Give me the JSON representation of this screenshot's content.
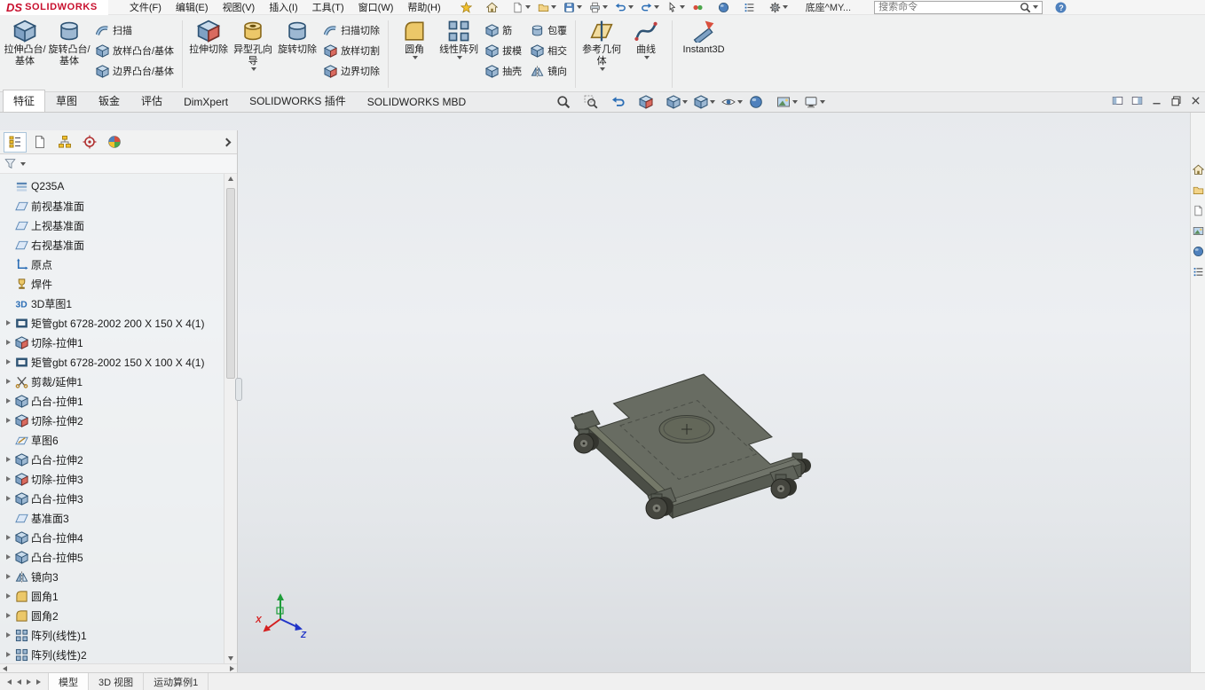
{
  "brand": {
    "ds": "DS",
    "name": "SOLIDWORKS"
  },
  "menubar": {
    "menus": [
      "文件(F)",
      "编辑(E)",
      "视图(V)",
      "插入(I)",
      "工具(T)",
      "窗口(W)",
      "帮助(H)"
    ],
    "quick_access": [
      {
        "icon": "favorites",
        "glyph": "star",
        "caret": false
      },
      {
        "icon": "home",
        "glyph": "home",
        "caret": false
      },
      {
        "icon": "new-document",
        "glyph": "page",
        "caret": true
      },
      {
        "icon": "open",
        "glyph": "folder",
        "caret": true
      },
      {
        "icon": "save",
        "glyph": "floppy",
        "caret": true
      },
      {
        "icon": "print",
        "glyph": "printer",
        "caret": true
      },
      {
        "icon": "undo",
        "glyph": "undo",
        "caret": true
      },
      {
        "icon": "redo",
        "glyph": "redo",
        "caret": true
      },
      {
        "icon": "select",
        "glyph": "cursor",
        "caret": true
      },
      {
        "icon": "rebuild",
        "glyph": "rebuild",
        "caret": false
      },
      {
        "icon": "appearances",
        "glyph": "sphere",
        "caret": false
      },
      {
        "icon": "file-properties",
        "glyph": "list",
        "caret": false
      },
      {
        "icon": "options",
        "glyph": "gear",
        "caret": true
      }
    ],
    "document_title": "底座^MY...",
    "search": {
      "placeholder": "搜索命令"
    }
  },
  "ribbon": {
    "extrude_boss": "拉伸凸台/基体",
    "revolve_boss": "旋转凸台/基体",
    "swept_boss": "扫描",
    "lofted_boss": "放样凸台/基体",
    "boundary_boss": "边界凸台/基体",
    "extruded_cut": "拉伸切除",
    "hole_wizard": "异型孔向导",
    "revolved_cut": "旋转切除",
    "swept_cut": "扫描切除",
    "lofted_cut": "放样切割",
    "boundary_cut": "边界切除",
    "fillet": "圆角",
    "linear_pattern": "线性阵列",
    "rib": "筋",
    "draft": "拔模",
    "shell": "抽壳",
    "wrap": "包覆",
    "intersect": "相交",
    "mirror": "镜向",
    "reference_geometry": "参考几何体",
    "curves": "曲线",
    "instant3d": "Instant3D"
  },
  "command_tabs": {
    "items": [
      "特征",
      "草图",
      "钣金",
      "评估",
      "DimXpert",
      "SOLIDWORKS 插件",
      "SOLIDWORKS MBD"
    ],
    "active_index": 0
  },
  "headsup": {
    "buttons": [
      {
        "icon": "zoom-to-fit",
        "glyph": "magnifier",
        "caret": false
      },
      {
        "icon": "zoom-to-area",
        "glyph": "zoomarea",
        "caret": false
      },
      {
        "icon": "previous-view",
        "glyph": "undo",
        "caret": false
      },
      {
        "icon": "section-view",
        "glyph": "cube-red",
        "caret": false
      },
      {
        "icon": "view-orientation",
        "glyph": "cube",
        "caret": true
      },
      {
        "icon": "display-style",
        "glyph": "cube",
        "caret": true
      },
      {
        "icon": "hide-show-items",
        "glyph": "eye",
        "caret": true
      },
      {
        "icon": "edit-appearance",
        "glyph": "sphere",
        "caret": false
      },
      {
        "icon": "apply-scene",
        "glyph": "photo",
        "caret": true
      },
      {
        "icon": "view-settings",
        "glyph": "monitor",
        "caret": true
      }
    ]
  },
  "window_controls": {
    "buttons": [
      {
        "icon": "toggle-left-pane",
        "glyph": "pane-left"
      },
      {
        "icon": "toggle-right-pane",
        "glyph": "pane-right"
      },
      {
        "icon": "minimize",
        "glyph": "win-min"
      },
      {
        "icon": "restore",
        "glyph": "win-restore"
      },
      {
        "icon": "close",
        "glyph": "win-close"
      }
    ]
  },
  "left_panel": {
    "tabs": [
      {
        "icon": "feature-manager",
        "glyph": "treeicon"
      },
      {
        "icon": "property-manager",
        "glyph": "page"
      },
      {
        "icon": "configuration-manager",
        "glyph": "branch"
      },
      {
        "icon": "dimxpert-manager",
        "glyph": "target"
      },
      {
        "icon": "display-manager",
        "glyph": "palette"
      }
    ],
    "tree_items": [
      {
        "label": "Q235A",
        "icon": "material",
        "glyph": "bars",
        "expand": false
      },
      {
        "label": "前视基准面",
        "icon": "reference-plane",
        "glyph": "plane",
        "expand": false
      },
      {
        "label": "上视基准面",
        "icon": "reference-plane",
        "glyph": "plane",
        "expand": false
      },
      {
        "label": "右视基准面",
        "icon": "reference-plane",
        "glyph": "plane",
        "expand": false
      },
      {
        "label": "原点",
        "icon": "origin",
        "glyph": "origin",
        "expand": false
      },
      {
        "label": "焊件",
        "icon": "weldment",
        "glyph": "trophy",
        "expand": false
      },
      {
        "label": "3D草图1",
        "icon": "sketch-3d",
        "glyph": "text3d",
        "expand": false
      },
      {
        "label": "矩管gbt 6728-2002 200 X 150 X 4(1)",
        "icon": "structural-member",
        "glyph": "frame",
        "expand": true
      },
      {
        "label": "切除-拉伸1",
        "icon": "cut-extrude",
        "glyph": "cube-red",
        "expand": true
      },
      {
        "label": "矩管gbt 6728-2002 150 X 100 X 4(1)",
        "icon": "structural-member",
        "glyph": "frame",
        "expand": true
      },
      {
        "label": "剪裁/延伸1",
        "icon": "trim-extend",
        "glyph": "scissors",
        "expand": true
      },
      {
        "label": "凸台-拉伸1",
        "icon": "boss-extrude",
        "glyph": "cube",
        "expand": true
      },
      {
        "label": "切除-拉伸2",
        "icon": "cut-extrude",
        "glyph": "cube-red",
        "expand": true
      },
      {
        "label": "草图6",
        "icon": "sketch",
        "glyph": "sketch",
        "expand": false
      },
      {
        "label": "凸台-拉伸2",
        "icon": "boss-extrude",
        "glyph": "cube",
        "expand": true
      },
      {
        "label": "切除-拉伸3",
        "icon": "cut-extrude",
        "glyph": "cube-red",
        "expand": true
      },
      {
        "label": "凸台-拉伸3",
        "icon": "boss-extrude",
        "glyph": "cube",
        "expand": true
      },
      {
        "label": "基准面3",
        "icon": "reference-plane",
        "glyph": "plane",
        "expand": false
      },
      {
        "label": "凸台-拉伸4",
        "icon": "boss-extrude",
        "glyph": "cube",
        "expand": true
      },
      {
        "label": "凸台-拉伸5",
        "icon": "boss-extrude",
        "glyph": "cube",
        "expand": true
      },
      {
        "label": "镜向3",
        "icon": "mirror",
        "glyph": "mirror2",
        "expand": true
      },
      {
        "label": "圆角1",
        "icon": "fillet",
        "glyph": "fillet",
        "expand": true
      },
      {
        "label": "圆角2",
        "icon": "fillet",
        "glyph": "fillet",
        "expand": true
      },
      {
        "label": "阵列(线性)1",
        "icon": "linear-pattern",
        "glyph": "pattern4",
        "expand": true
      },
      {
        "label": "阵列(线性)2",
        "icon": "linear-pattern",
        "glyph": "pattern4",
        "expand": true
      }
    ]
  },
  "viewport": {
    "triad": {
      "x": "X",
      "z": "Z"
    }
  },
  "task_pane": {
    "tabs": [
      {
        "icon": "solidworks-resources",
        "glyph": "home"
      },
      {
        "icon": "design-library",
        "glyph": "folder"
      },
      {
        "icon": "file-explorer",
        "glyph": "page"
      },
      {
        "icon": "view-palette",
        "glyph": "photo"
      },
      {
        "icon": "appearances-scenes",
        "glyph": "sphere"
      },
      {
        "icon": "custom-properties",
        "glyph": "list"
      }
    ]
  },
  "status_bar": {
    "tabs": [
      "模型",
      "3D 视图",
      "运动算例1"
    ],
    "active_index": 0
  }
}
